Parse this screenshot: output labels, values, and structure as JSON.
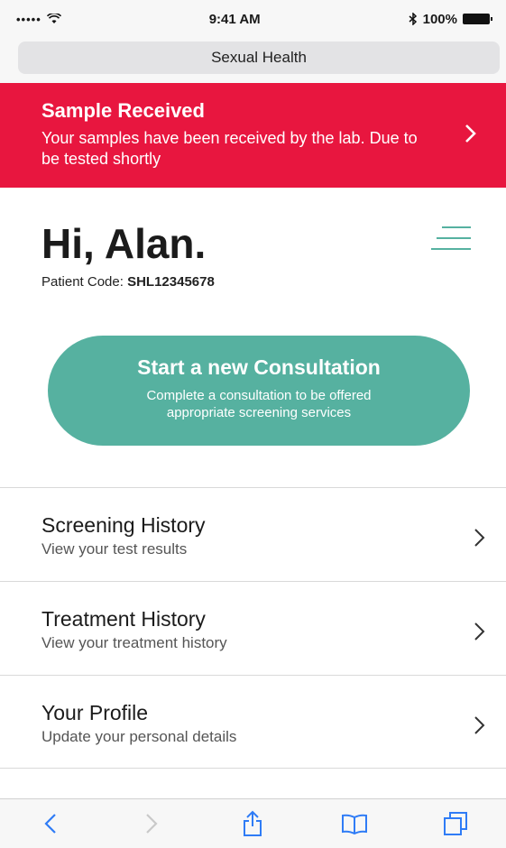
{
  "status_bar": {
    "signal": "•••••",
    "time": "9:41 AM",
    "battery_text": "100%"
  },
  "browser": {
    "url_title": "Sexual Health"
  },
  "banner": {
    "title": "Sample Received",
    "text": "Your samples have been received by the lab. Due to be tested shortly",
    "color": "#e8163f"
  },
  "header": {
    "greeting": "Hi, Alan.",
    "patient_code_label": "Patient Code:",
    "patient_code_value": "SHL12345678"
  },
  "cta": {
    "title": "Start a new Consultation",
    "subtitle": "Complete a consultation to be offered appropriate screening services",
    "color": "#56b1a0"
  },
  "list": [
    {
      "title": "Screening History",
      "subtitle": "View your test results"
    },
    {
      "title": "Treatment History",
      "subtitle": "View your treatment history"
    },
    {
      "title": "Your Profile",
      "subtitle": "Update your personal details"
    }
  ],
  "toolbar": {
    "icons": [
      "back-icon",
      "forward-icon",
      "share-icon",
      "bookmarks-icon",
      "tabs-icon"
    ]
  }
}
